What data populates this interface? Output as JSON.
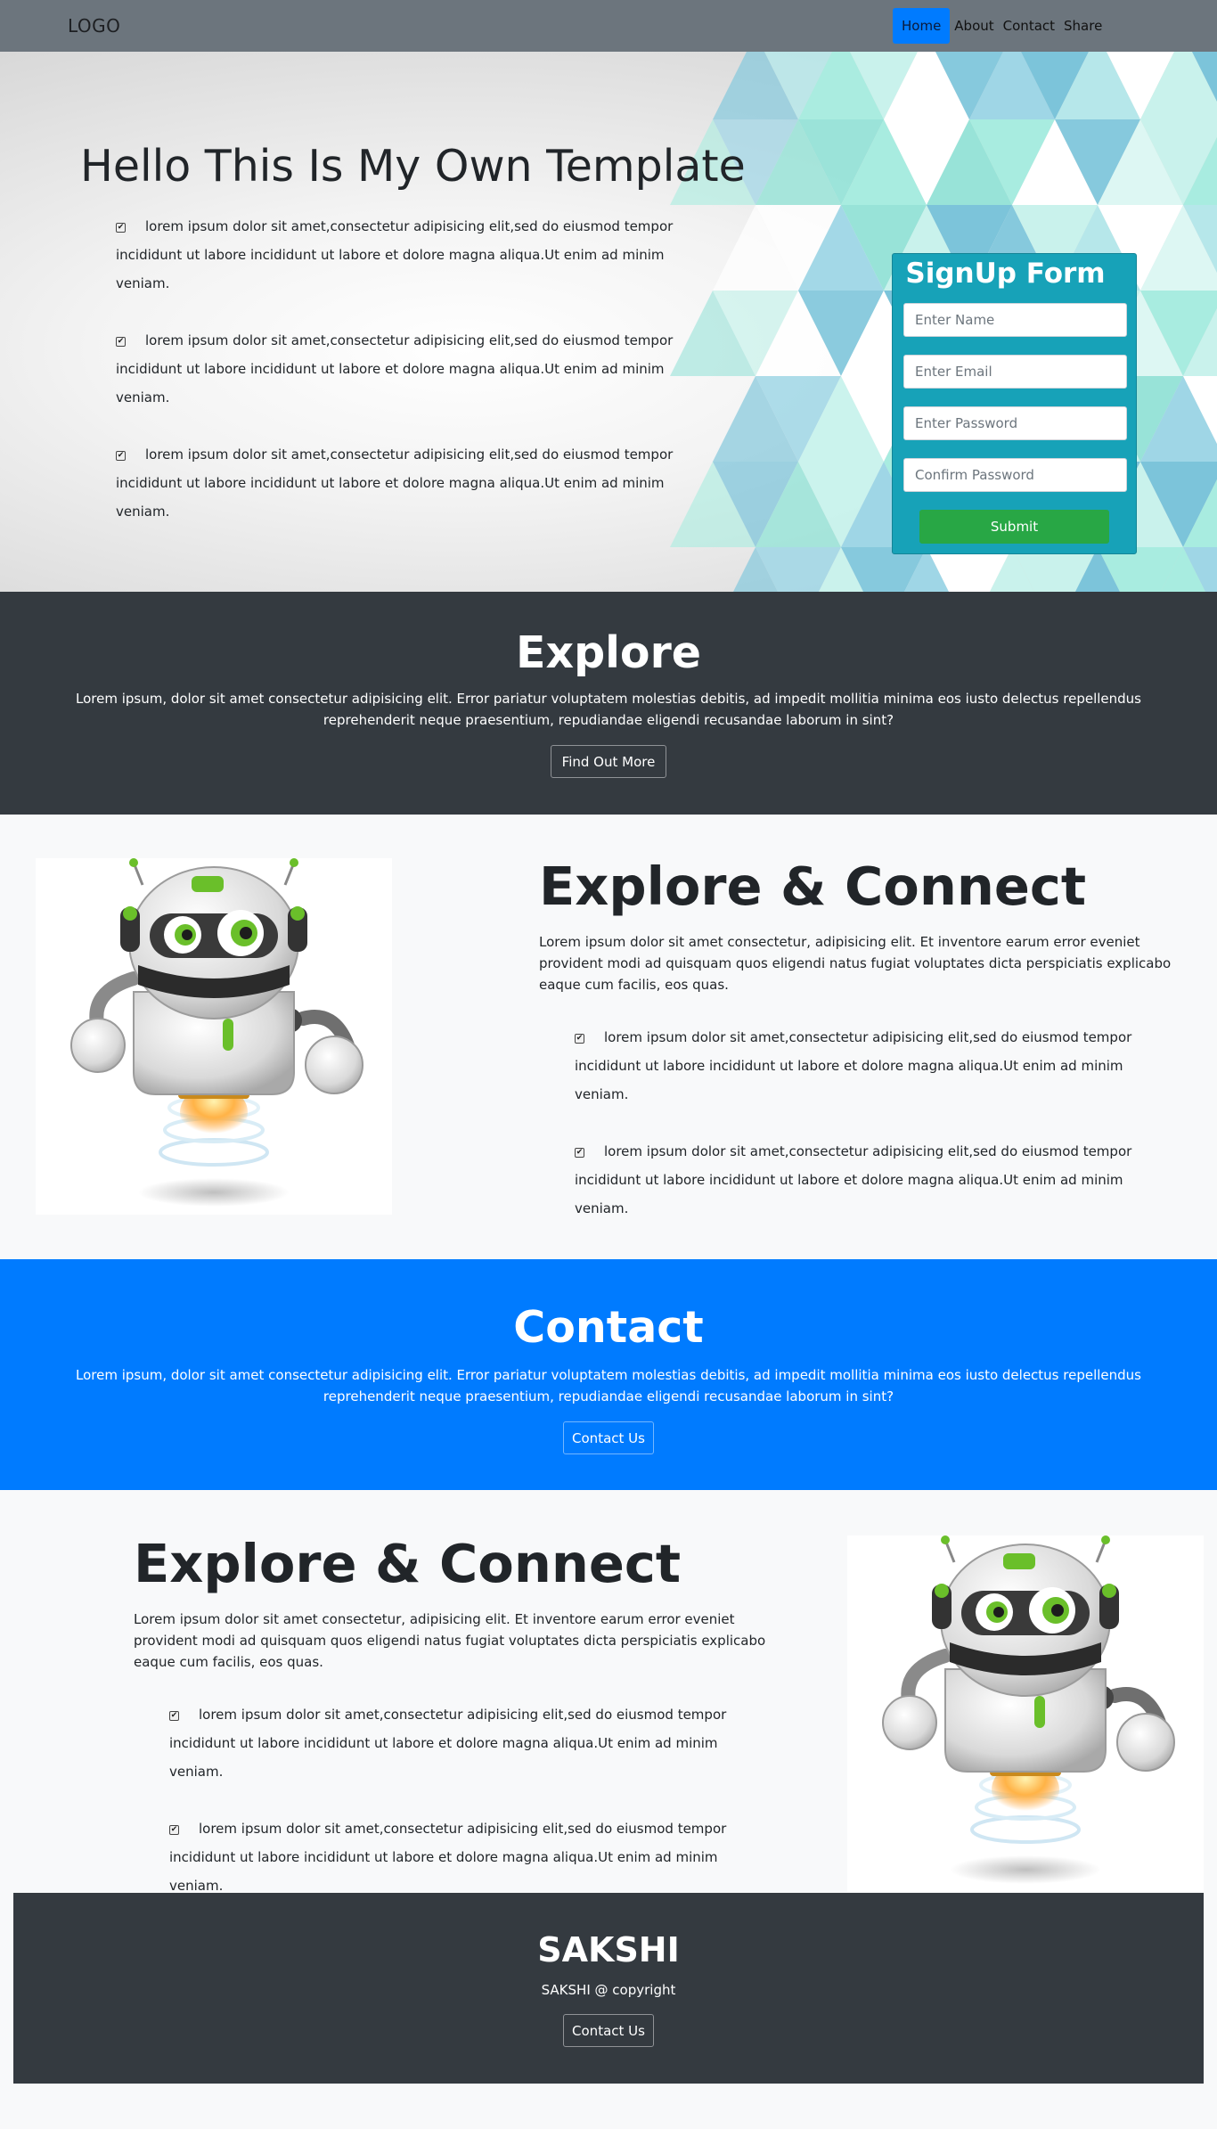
{
  "nav": {
    "logo": "LOGO",
    "links": [
      "Home",
      "About",
      "Contact",
      "Share"
    ],
    "active": "Home"
  },
  "hero": {
    "title": "Hello This Is My Own Template",
    "items": [
      "lorem ipsum dolor sit amet,consectetur adipisicing elit,sed do eiusmod tempor incididunt ut labore incididunt ut labore et dolore magna aliqua.Ut enim ad minim veniam.",
      "lorem ipsum dolor sit amet,consectetur adipisicing elit,sed do eiusmod tempor incididunt ut labore incididunt ut labore et dolore magna aliqua.Ut enim ad minim veniam.",
      "lorem ipsum dolor sit amet,consectetur adipisicing elit,sed do eiusmod tempor incididunt ut labore incididunt ut labore et dolore magna aliqua.Ut enim ad minim veniam."
    ]
  },
  "signup": {
    "title": "SignUp Form",
    "name_placeholder": "Enter Name",
    "email_placeholder": "Enter Email",
    "password_placeholder": "Enter Password",
    "confirm_placeholder": "Confirm Password",
    "submit_label": "Submit"
  },
  "explore": {
    "title": "Explore",
    "text": "Lorem ipsum, dolor sit amet consectetur adipisicing elit. Error pariatur voluptatem molestias debitis, ad impedit mollitia minima eos iusto delectus repellendus reprehenderit neque praesentium, repudiandae eligendi recusandae laborum in sint?",
    "button": "Find Out More"
  },
  "feature1": {
    "title": "Explore & Connect",
    "text": "Lorem ipsum dolor sit amet consectetur, adipisicing elit. Et inventore earum error eveniet provident modi ad quisquam quos eligendi natus fugiat voluptates dicta perspiciatis explicabo eaque cum facilis, eos quas.",
    "items": [
      "lorem ipsum dolor sit amet,consectetur adipisicing elit,sed do eiusmod tempor incididunt ut labore incididunt ut labore et dolore magna aliqua.Ut enim ad minim veniam.",
      "lorem ipsum dolor sit amet,consectetur adipisicing elit,sed do eiusmod tempor incididunt ut labore incididunt ut labore et dolore magna aliqua.Ut enim ad minim veniam."
    ]
  },
  "contact": {
    "title": "Contact",
    "text": "Lorem ipsum, dolor sit amet consectetur adipisicing elit. Error pariatur voluptatem molestias debitis, ad impedit mollitia minima eos iusto delectus repellendus reprehenderit neque praesentium, repudiandae eligendi recusandae laborum in sint?",
    "button": "Contact Us"
  },
  "feature2": {
    "title": "Explore & Connect",
    "text": "Lorem ipsum dolor sit amet consectetur, adipisicing elit. Et inventore earum error eveniet provident modi ad quisquam quos eligendi natus fugiat voluptates dicta perspiciatis explicabo eaque cum facilis, eos quas.",
    "items": [
      "lorem ipsum dolor sit amet,consectetur adipisicing elit,sed do eiusmod tempor incididunt ut labore incididunt ut labore et dolore magna aliqua.Ut enim ad minim veniam.",
      "lorem ipsum dolor sit amet,consectetur adipisicing elit,sed do eiusmod tempor incididunt ut labore incididunt ut labore et dolore magna aliqua.Ut enim ad minim veniam."
    ]
  },
  "footer": {
    "title": "SAKSHI",
    "copyright": "SAKSHI @ copyright",
    "button": "Contact Us"
  },
  "colors": {
    "nav": "#6c757d",
    "primary": "#007bff",
    "dark": "#343a40",
    "info": "#17a2b8",
    "success": "#28a745"
  },
  "icons": [
    "checkbox-checked-icon",
    "robot-illustration"
  ]
}
